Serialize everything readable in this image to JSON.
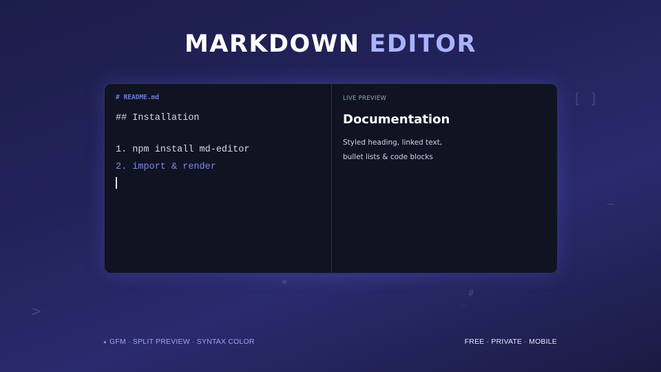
{
  "header": {
    "title_main": "MARKDOWN",
    "title_accent": "EDITOR"
  },
  "editor": {
    "filename": "# README.md",
    "lines": [
      "## Installation",
      "1. npm install md-editor",
      "2. import & render"
    ]
  },
  "preview": {
    "label": "LIVE PREVIEW",
    "heading": "Documentation",
    "body_lines": [
      "Styled heading, linked text,",
      "bullet lists & code blocks"
    ]
  },
  "footer": {
    "left_text": "GFM · SPLIT PREVIEW · SYNTAX COLOR",
    "right_text": "FREE · PRIVATE · MOBILE"
  },
  "decorations": {
    "brackets": "[ ]",
    "dash": "—",
    "star": "★",
    "prompt": ">",
    "hash": "#",
    "underscore": "_"
  },
  "colors": {
    "accent": "#aab3ff",
    "card_bg": "#0f1322",
    "code_accent": "#7e86e8"
  }
}
